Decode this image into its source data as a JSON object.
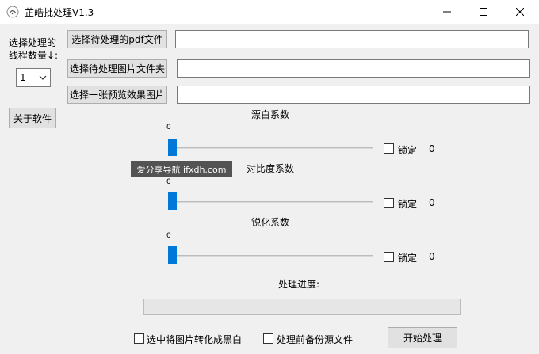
{
  "window": {
    "title": "芷皓批处理V1.3",
    "icon": "app-logo-icon",
    "controls": [
      "minimize-icon",
      "maximize-icon",
      "close-icon"
    ]
  },
  "threads": {
    "label_line1": "选择处理的",
    "label_line2": "线程数量↓:",
    "selected": "1"
  },
  "about_button": "关于软件",
  "file_rows": [
    {
      "button": "选择待处理的pdf文件",
      "value": ""
    },
    {
      "button": "选择待处理图片文件夹",
      "value": ""
    },
    {
      "button": "选择一张预览效果图片",
      "value": ""
    }
  ],
  "sliders": [
    {
      "title": "漂白系数",
      "min_label": "0",
      "lock_label": "锁定",
      "value": "0",
      "locked": false,
      "level": 0
    },
    {
      "title": "对比度系数",
      "min_label": "0",
      "lock_label": "锁定",
      "value": "0",
      "locked": false,
      "level": 0
    },
    {
      "title": "锐化系数",
      "min_label": "0",
      "lock_label": "锁定",
      "value": "0",
      "locked": false,
      "level": 0
    }
  ],
  "progress": {
    "label": "处理进度:",
    "percent": 0
  },
  "options": {
    "to_bw": {
      "label": "选中将图片转化成黑白",
      "checked": false
    },
    "backup": {
      "label": "处理前备份源文件",
      "checked": false
    }
  },
  "start_button": "开始处理",
  "watermark": "爱分享导航 ifxdh.com",
  "colors": {
    "accent": "#0078d7",
    "titlebar": "#ffffff",
    "background": "#f0f0f0"
  }
}
